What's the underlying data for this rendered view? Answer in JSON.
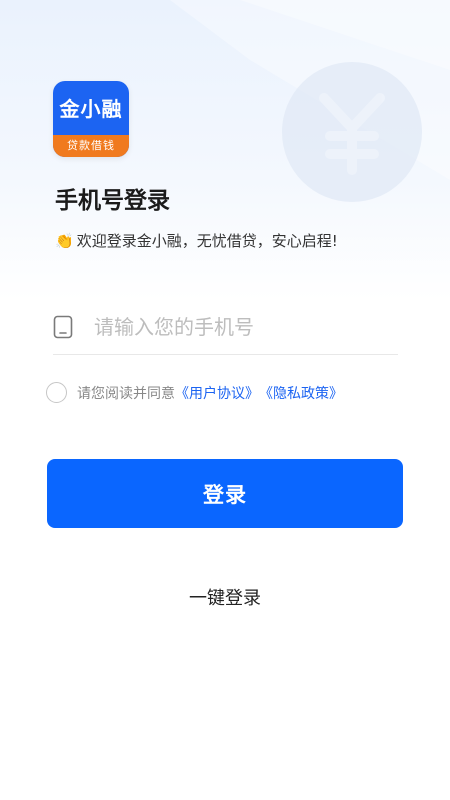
{
  "brand": {
    "app_name": "金小融",
    "tagline": "贷款借钱",
    "colors": {
      "primary": "#0a66ff",
      "accent": "#f07a1e",
      "link": "#1c64f2"
    }
  },
  "page": {
    "title": "手机号登录",
    "welcome_emoji": "👏",
    "welcome_text": "欢迎登录金小融，无忧借贷，安心启程!"
  },
  "phone": {
    "icon": "phone-icon",
    "placeholder": "请输入您的手机号",
    "value": ""
  },
  "agreement": {
    "checked": false,
    "prefix": "请您阅读并同意",
    "user_agreement": "《用户协议》",
    "privacy_policy": "《隐私政策》"
  },
  "actions": {
    "login_label": "登录",
    "one_click_login_label": "一键登录"
  }
}
